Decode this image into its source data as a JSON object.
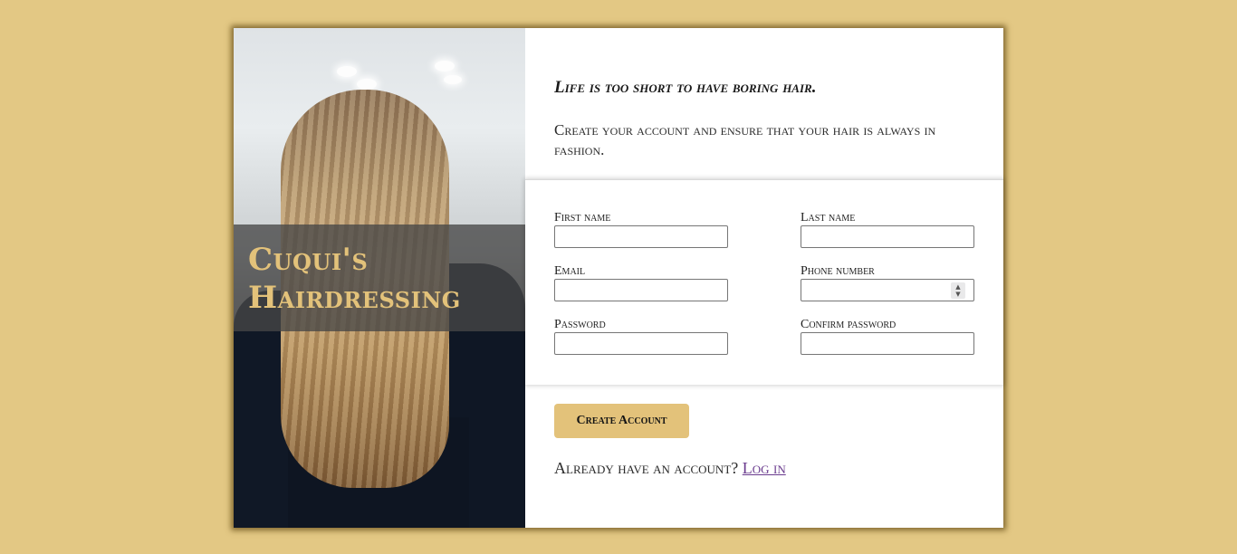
{
  "brand": {
    "line1": "Cuqui's",
    "line2": "Hairdressing"
  },
  "tagline": "Life is too short to have boring hair.",
  "intro": "Create your account and ensure that your hair is always in fashion.",
  "form": {
    "first_name": {
      "label": "First name",
      "value": ""
    },
    "last_name": {
      "label": "Last name",
      "value": ""
    },
    "email": {
      "label": "Email",
      "value": ""
    },
    "phone": {
      "label": "Phone number",
      "value": ""
    },
    "password": {
      "label": "Password",
      "value": ""
    },
    "confirm_password": {
      "label": "Confirm password",
      "value": ""
    }
  },
  "actions": {
    "create_label": "Create Account",
    "login_prompt": "Already have an account?",
    "login_link": "Log in"
  },
  "colors": {
    "background": "#e3c884",
    "accent": "#e3c27a",
    "link": "#6a3b8e"
  }
}
